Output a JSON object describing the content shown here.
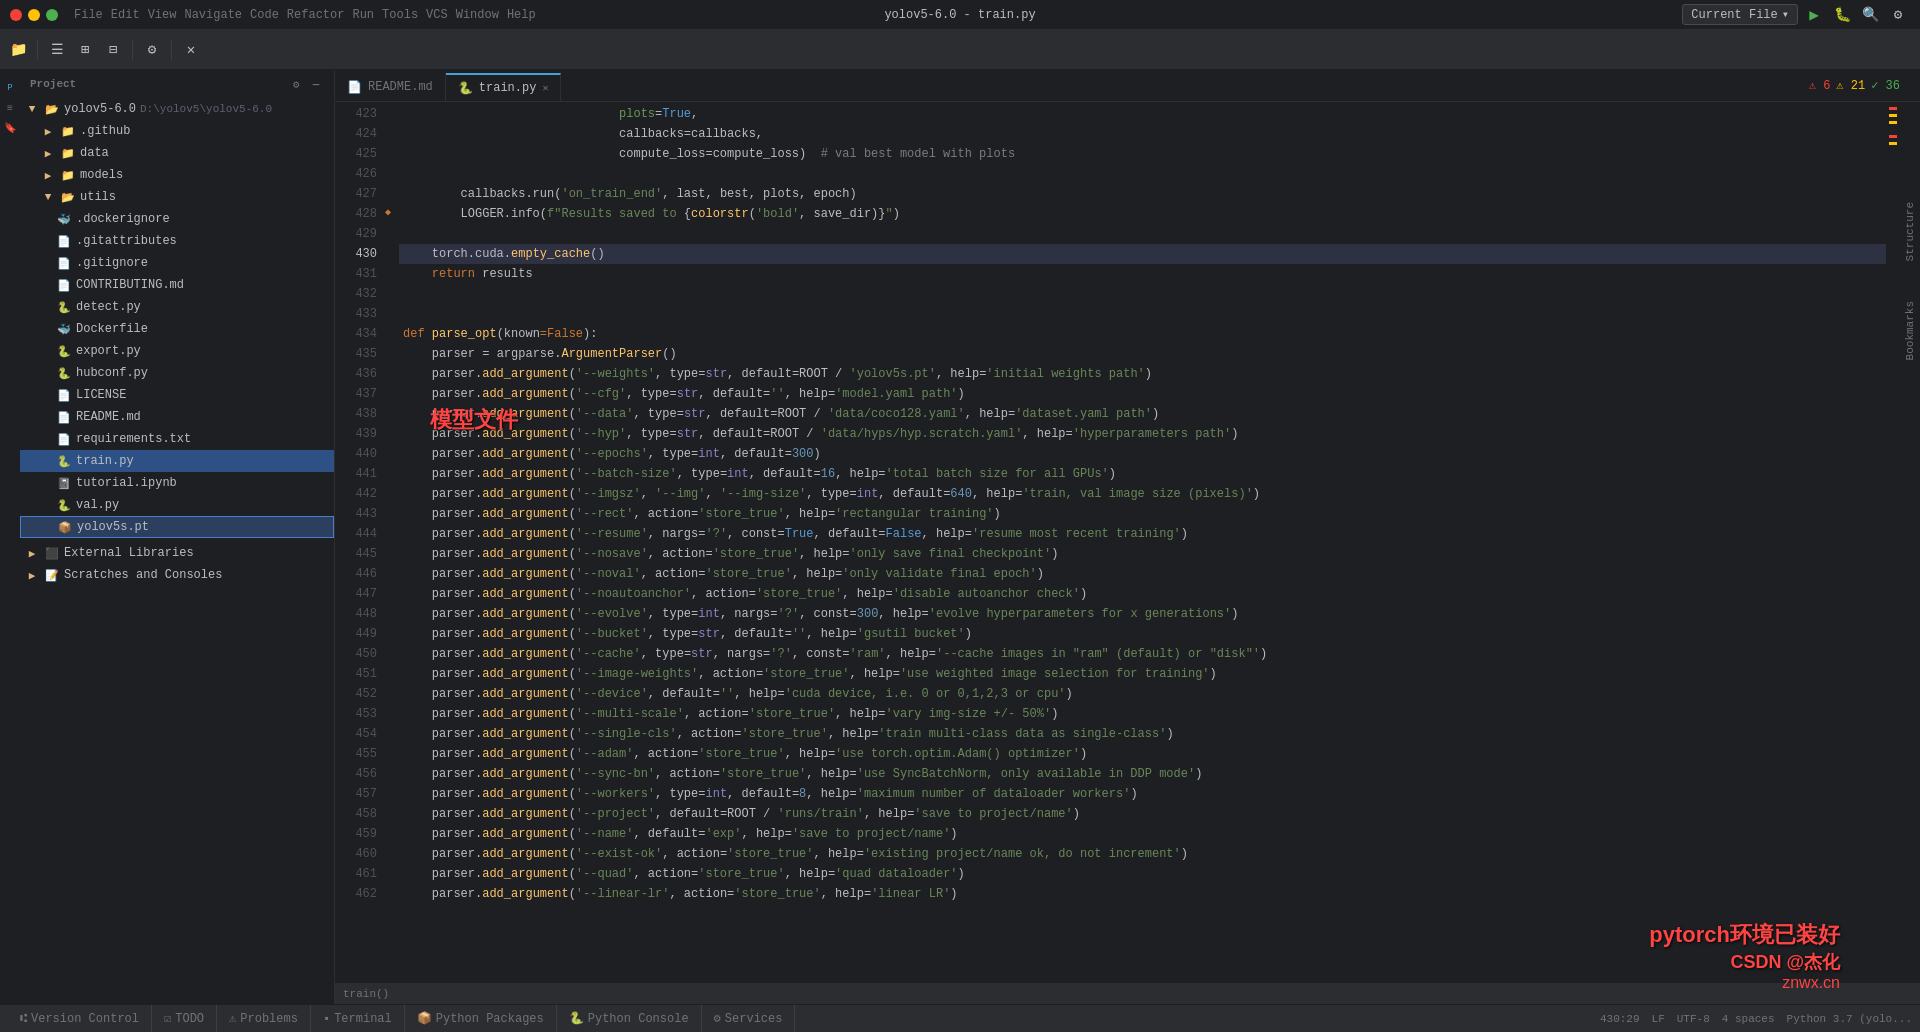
{
  "app": {
    "title": "yolov5-6.0 - train.py",
    "project_name": "yolov5-6.0",
    "file_name": "train.py"
  },
  "menu": {
    "items": [
      "File",
      "Edit",
      "View",
      "Navigate",
      "Code",
      "Refactor",
      "Run",
      "Tools",
      "VCS",
      "Window",
      "Help"
    ]
  },
  "toolbar": {
    "current_file_label": "Current File",
    "run_label": "▶",
    "debug_label": "🐛"
  },
  "breadcrumb": {
    "project": "Project",
    "version": "yolov5-6.0",
    "path": "D:\\yolov5\\yolov5-6.0"
  },
  "tabs": [
    {
      "label": "README.md",
      "icon": "md",
      "active": false
    },
    {
      "label": "train.py",
      "icon": "py",
      "active": true
    }
  ],
  "status": {
    "errors": "⚠ 6",
    "warnings": "⚠ 21",
    "ok": "✓ 36",
    "position": "430:29",
    "encoding": "UTF-8",
    "indent": "4 spaces",
    "python": "Python 3.7 (yolo..."
  },
  "file_tree": {
    "project_label": "Project",
    "root": "yolov5-6.0",
    "root_path": "D:\\yolov5\\yolov5-6.0",
    "items": [
      {
        "name": ".github",
        "type": "folder",
        "indent": 1
      },
      {
        "name": "data",
        "type": "folder",
        "indent": 1
      },
      {
        "name": "models",
        "type": "folder",
        "indent": 1
      },
      {
        "name": "utils",
        "type": "folder",
        "indent": 1
      },
      {
        "name": ".dockerignore",
        "type": "txt",
        "indent": 2
      },
      {
        "name": ".gitattributes",
        "type": "txt",
        "indent": 2
      },
      {
        "name": ".gitignore",
        "type": "txt",
        "indent": 2
      },
      {
        "name": "CONTRIBUTING.md",
        "type": "md",
        "indent": 2
      },
      {
        "name": "detect.py",
        "type": "py",
        "indent": 2
      },
      {
        "name": "Dockerfile",
        "type": "docker",
        "indent": 2
      },
      {
        "name": "export.py",
        "type": "py",
        "indent": 2
      },
      {
        "name": "hubconf.py",
        "type": "py",
        "indent": 2
      },
      {
        "name": "LICENSE",
        "type": "license",
        "indent": 2
      },
      {
        "name": "README.md",
        "type": "md",
        "indent": 2
      },
      {
        "name": "requirements.txt",
        "type": "txt",
        "indent": 2
      },
      {
        "name": "train.py",
        "type": "py",
        "indent": 2,
        "selected": true
      },
      {
        "name": "tutorial.ipynb",
        "type": "py",
        "indent": 2
      },
      {
        "name": "val.py",
        "type": "py",
        "indent": 2
      },
      {
        "name": "yolov5s.pt",
        "type": "pt",
        "indent": 2,
        "highlighted": true
      }
    ],
    "external_libraries": "External Libraries",
    "scratches": "Scratches and Consoles"
  },
  "code": {
    "lines": [
      {
        "num": 423,
        "content": "                              plots=True,",
        "gutter": ""
      },
      {
        "num": 424,
        "content": "                              callbacks=callbacks,",
        "gutter": ""
      },
      {
        "num": 425,
        "content": "                              compute_loss=compute_loss)  # val best model with plots",
        "gutter": ""
      },
      {
        "num": 426,
        "content": "",
        "gutter": ""
      },
      {
        "num": 427,
        "content": "        callbacks.run('on_train_end', last, best, plots, epoch)",
        "gutter": ""
      },
      {
        "num": 428,
        "content": "        LOGGER.info(f\"Results saved to {colorstr('bold', save_dir)}\")",
        "gutter": "◆"
      },
      {
        "num": 429,
        "content": "",
        "gutter": ""
      },
      {
        "num": 430,
        "content": "    torch.cuda.empty_cache()",
        "gutter": ""
      },
      {
        "num": 431,
        "content": "    return results",
        "gutter": ""
      },
      {
        "num": 432,
        "content": "",
        "gutter": ""
      },
      {
        "num": 433,
        "content": "",
        "gutter": ""
      },
      {
        "num": 434,
        "content": "def parse_opt(known=False):",
        "gutter": ""
      },
      {
        "num": 435,
        "content": "    parser = argparse.ArgumentParser()",
        "gutter": ""
      },
      {
        "num": 436,
        "content": "    parser.add_argument('--weights', type=str, default=ROOT / 'yolov5s.pt', help='initial weights path')",
        "gutter": ""
      },
      {
        "num": 437,
        "content": "    parser.add_argument('--cfg', type=str, default='', help='model.yaml path')",
        "gutter": ""
      },
      {
        "num": 438,
        "content": "    parser.add_argument('--data', type=str, default=ROOT / 'data/coco128.yaml', help='dataset.yaml path')",
        "gutter": ""
      },
      {
        "num": 439,
        "content": "    parser.add_argument('--hyp', type=str, default=ROOT / 'data/hyps/hyp.scratch.yaml', help='hyperparameters path')",
        "gutter": ""
      },
      {
        "num": 440,
        "content": "    parser.add_argument('--epochs', type=int, default=300)",
        "gutter": ""
      },
      {
        "num": 441,
        "content": "    parser.add_argument('--batch-size', type=int, default=16, help='total batch size for all GPUs')",
        "gutter": ""
      },
      {
        "num": 442,
        "content": "    parser.add_argument('--imgsz', '--img', '--img-size', type=int, default=640, help='train, val image size (pixels)')",
        "gutter": ""
      },
      {
        "num": 443,
        "content": "    parser.add_argument('--rect', action='store_true', help='rectangular training')",
        "gutter": ""
      },
      {
        "num": 444,
        "content": "    parser.add_argument('--resume', nargs='?', const=True, default=False, help='resume most recent training')",
        "gutter": ""
      },
      {
        "num": 445,
        "content": "    parser.add_argument('--nosave', action='store_true', help='only save final checkpoint')",
        "gutter": ""
      },
      {
        "num": 446,
        "content": "    parser.add_argument('--noval', action='store_true', help='only validate final epoch')",
        "gutter": ""
      },
      {
        "num": 447,
        "content": "    parser.add_argument('--noautoanchor', action='store_true', help='disable autoanchor check')",
        "gutter": ""
      },
      {
        "num": 448,
        "content": "    parser.add_argument('--evolve', type=int, nargs='?', const=300, help='evolve hyperparameters for x generations')",
        "gutter": ""
      },
      {
        "num": 449,
        "content": "    parser.add_argument('--bucket', type=str, default='', help='gsutil bucket')",
        "gutter": ""
      },
      {
        "num": 450,
        "content": "    parser.add_argument('--cache', type=str, nargs='?', const='ram', help='--cache images in \"ram\" (default) or \"disk\"')",
        "gutter": ""
      },
      {
        "num": 451,
        "content": "    parser.add_argument('--image-weights', action='store_true', help='use weighted image selection for training')",
        "gutter": ""
      },
      {
        "num": 452,
        "content": "    parser.add_argument('--device', default='', help='cuda device, i.e. 0 or 0,1,2,3 or cpu')",
        "gutter": ""
      },
      {
        "num": 453,
        "content": "    parser.add_argument('--multi-scale', action='store_true', help='vary img-size +/- 50%')",
        "gutter": ""
      },
      {
        "num": 454,
        "content": "    parser.add_argument('--single-cls', action='store_true', help='train multi-class data as single-class')",
        "gutter": ""
      },
      {
        "num": 455,
        "content": "    parser.add_argument('--adam', action='store_true', help='use torch.optim.Adam() optimizer')",
        "gutter": ""
      },
      {
        "num": 456,
        "content": "    parser.add_argument('--sync-bn', action='store_true', help='use SyncBatchNorm, only available in DDP mode')",
        "gutter": ""
      },
      {
        "num": 457,
        "content": "    parser.add_argument('--workers', type=int, default=8, help='maximum number of dataloader workers')",
        "gutter": ""
      },
      {
        "num": 458,
        "content": "    parser.add_argument('--project', default=ROOT / 'runs/train', help='save to project/name')",
        "gutter": ""
      },
      {
        "num": 459,
        "content": "    parser.add_argument('--name', default='exp', help='save to project/name')",
        "gutter": ""
      },
      {
        "num": 460,
        "content": "    parser.add_argument('--exist-ok', action='store_true', help='existing project/name ok, do not increment')",
        "gutter": ""
      },
      {
        "num": 461,
        "content": "    parser.add_argument('--quad', action='store_true', help='quad dataloader')",
        "gutter": ""
      },
      {
        "num": 462,
        "content": "    parser.add_argument('--linear-lr', action='store_true', help='linear LR')",
        "gutter": ""
      }
    ]
  },
  "bottom_tabs": [
    {
      "label": "Version Control",
      "icon": "⑆",
      "active": false
    },
    {
      "label": "TODO",
      "icon": "☑",
      "active": false
    },
    {
      "label": "Problems",
      "icon": "⚠",
      "active": false
    },
    {
      "label": "Terminal",
      "icon": "▪",
      "active": false
    },
    {
      "label": "Python Packages",
      "icon": "📦",
      "active": false
    },
    {
      "label": "Python Console",
      "icon": "🐍",
      "active": false
    },
    {
      "label": "Services",
      "icon": "⚙",
      "active": false
    }
  ],
  "annotations": {
    "model_file_zh": "模型文件",
    "pytorch_zh": "pytorch环境已装好",
    "csdn": "CSDN @杰化",
    "csdn_sub": "znwx.cn"
  },
  "footer": {
    "position": "430:29",
    "lf": "LF",
    "encoding": "UTF-8",
    "indent": "4 spaces",
    "python_version": "Python 3.7 (yolo..."
  },
  "function_nav": "train()"
}
